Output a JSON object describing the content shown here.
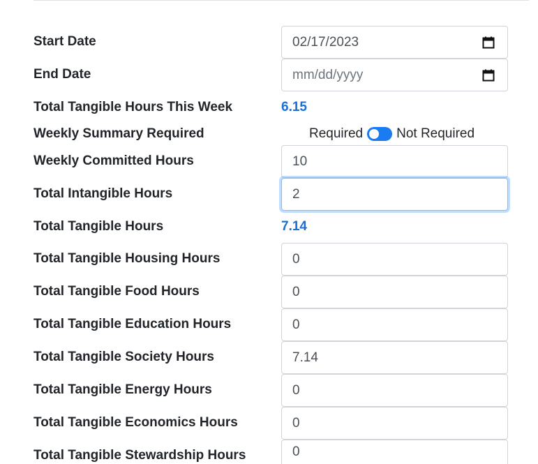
{
  "form": {
    "start_date": {
      "label": "Start Date",
      "value": "02/17/2023"
    },
    "end_date": {
      "label": "End Date",
      "placeholder": "mm/dd/yyyy"
    },
    "tangible_this_week": {
      "label": "Total Tangible Hours This Week",
      "value": "6.15"
    },
    "weekly_summary": {
      "label": "Weekly Summary Required",
      "option_left": "Required",
      "option_right": "Not Required"
    },
    "weekly_committed": {
      "label": "Weekly Committed Hours",
      "value": "10"
    },
    "intangible": {
      "label": "Total Intangible Hours",
      "value": "2"
    },
    "tangible_total": {
      "label": "Total Tangible Hours",
      "value": "7.14"
    },
    "housing": {
      "label": "Total Tangible Housing Hours",
      "value": "0"
    },
    "food": {
      "label": "Total Tangible Food Hours",
      "value": "0"
    },
    "education": {
      "label": "Total Tangible Education Hours",
      "value": "0"
    },
    "society": {
      "label": "Total Tangible Society Hours",
      "value": "7.14"
    },
    "energy": {
      "label": "Total Tangible Energy Hours",
      "value": "0"
    },
    "economics": {
      "label": "Total Tangible Economics Hours",
      "value": "0"
    },
    "stewardship": {
      "label": "Total Tangible Stewardship Hours",
      "value": "0"
    }
  },
  "colors": {
    "accent": "#1a6fcf",
    "switch": "#1a7cf0",
    "focus_border": "#80bdff"
  }
}
